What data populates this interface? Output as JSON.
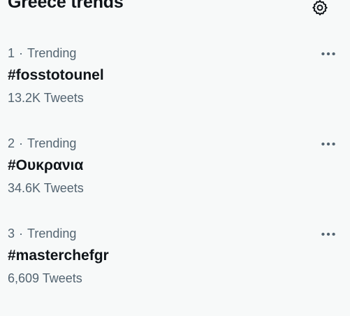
{
  "header": {
    "title": "Greece trends",
    "settings_icon": "gear-icon"
  },
  "trends": [
    {
      "rank": "1",
      "separator": "·",
      "category": "Trending",
      "name": "#fosstotounel",
      "count": "13.2K Tweets",
      "more_icon": "more-horizontal-icon"
    },
    {
      "rank": "2",
      "separator": "·",
      "category": "Trending",
      "name": "#Ουκρανια",
      "count": "34.6K Tweets",
      "more_icon": "more-horizontal-icon"
    },
    {
      "rank": "3",
      "separator": "·",
      "category": "Trending",
      "name": "#masterchefgr",
      "count": "6,609 Tweets",
      "more_icon": "more-horizontal-icon"
    }
  ],
  "colors": {
    "background": "#f7f9f9",
    "primary_text": "#0f1419",
    "secondary_text": "#536471"
  }
}
